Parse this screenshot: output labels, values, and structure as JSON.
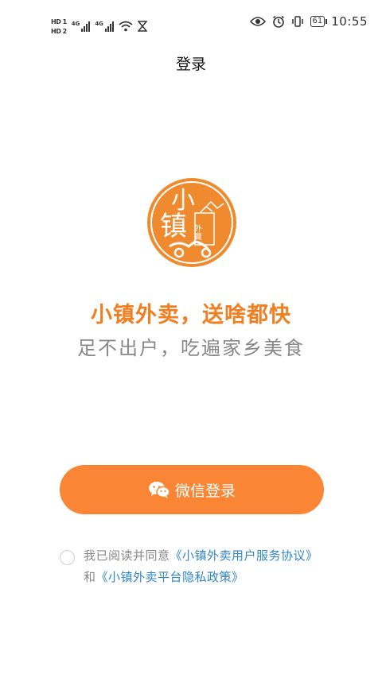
{
  "status_bar": {
    "hd1": "HD 1",
    "hd2": "HD 2",
    "net1": "4G",
    "net2": "4G",
    "battery": "61",
    "time": "10:55",
    "icons": [
      "eye-icon",
      "alarm-icon",
      "vibrate-icon",
      "battery-icon",
      "wifi-icon",
      "hourglass-icon"
    ]
  },
  "page": {
    "title": "登录"
  },
  "logo": {
    "big_char1": "小",
    "big_char2": "镇",
    "small_text": "外賣"
  },
  "slogan": {
    "line1": "小镇外卖，送啥都快",
    "line2": "足不出户，吃遍家乡美食"
  },
  "login": {
    "wechat_label": "微信登录",
    "icon": "wechat-icon"
  },
  "agreement": {
    "prefix": "我已阅读并同意",
    "service_link": "《小镇外卖用户服务协议》",
    "conjunction": "和",
    "privacy_link": "《小镇外卖平台隐私政策》"
  },
  "colors": {
    "brand_orange": "#fa8635",
    "slogan_orange": "#f07f22",
    "link_blue": "#2f86c8",
    "logo_orange": "#ef8a2f"
  }
}
